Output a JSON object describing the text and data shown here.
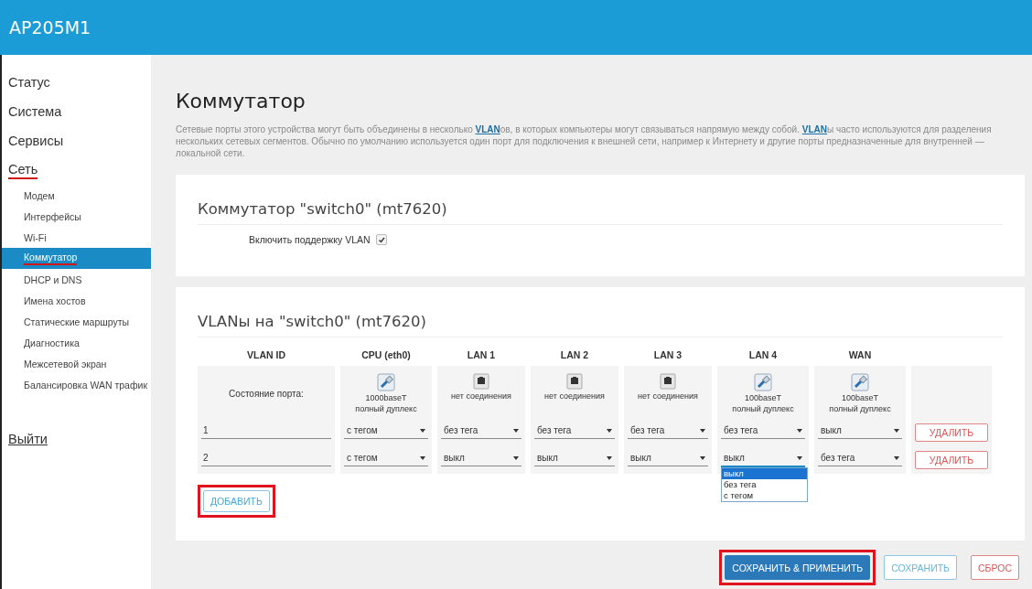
{
  "header": {
    "title": "AP205M1"
  },
  "sidebar": {
    "items": [
      {
        "label": "Статус",
        "selected": false,
        "annotated": false
      },
      {
        "label": "Система",
        "selected": false,
        "annotated": false
      },
      {
        "label": "Сервисы",
        "selected": false,
        "annotated": false
      },
      {
        "label": "Сеть",
        "selected": false,
        "annotated": true,
        "children": [
          {
            "label": "Модем",
            "selected": false,
            "annotated": false
          },
          {
            "label": "Интерфейсы",
            "selected": false,
            "annotated": false
          },
          {
            "label": "Wi-Fi",
            "selected": false,
            "annotated": false
          },
          {
            "label": "Коммутатор",
            "selected": true,
            "annotated": true
          },
          {
            "label": "DHCP и DNS",
            "selected": false,
            "annotated": false
          },
          {
            "label": "Имена хостов",
            "selected": false,
            "annotated": false
          },
          {
            "label": "Статические маршруты",
            "selected": false,
            "annotated": false
          },
          {
            "label": "Диагностика",
            "selected": false,
            "annotated": false
          },
          {
            "label": "Межсетевой экран",
            "selected": false,
            "annotated": false
          },
          {
            "label": "Балансировка WAN трафик",
            "selected": false,
            "annotated": false
          }
        ]
      }
    ],
    "logout": "Выйти"
  },
  "page": {
    "title": "Коммутатор",
    "description": [
      {
        "kind": "text",
        "text": "Сетевые порты этого устройства могут быть объединены в несколько "
      },
      {
        "kind": "link",
        "text": "VLAN"
      },
      {
        "kind": "text",
        "text": "ов, в которых компьютеры могут связываться напрямую между собой. "
      },
      {
        "kind": "link",
        "text": "VLAN"
      },
      {
        "kind": "text",
        "text": "ы часто используются для разделения нескольких сетевых сегментов. Обычно по умолчанию используется один порт для подключения к внешней сети, например к Интернету и другие порты предназначенные для внутренней — локальной сети."
      }
    ]
  },
  "switch_card": {
    "title": "Коммутатор \"switch0\" (mt7620)",
    "vlan_support": {
      "label": "Включить поддержку VLAN",
      "checked": true
    }
  },
  "vlan_card": {
    "title": "VLANы на \"switch0\" (mt7620)",
    "columns": [
      "VLAN ID",
      "CPU (eth0)",
      "LAN 1",
      "LAN 2",
      "LAN 3",
      "LAN 4",
      "WAN"
    ],
    "port_status_label": "Состояние порта:",
    "ports": [
      {
        "connected": true,
        "lines": [
          "1000baseT",
          "полный дуплекс"
        ]
      },
      {
        "connected": false,
        "lines": [
          "нет соединения"
        ]
      },
      {
        "connected": false,
        "lines": [
          "нет соединения"
        ]
      },
      {
        "connected": false,
        "lines": [
          "нет соединения"
        ]
      },
      {
        "connected": true,
        "lines": [
          "100baseT",
          "полный дуплекс"
        ]
      },
      {
        "connected": true,
        "lines": [
          "100baseT",
          "полный дуплекс"
        ]
      }
    ],
    "rows": [
      {
        "cells": [
          {
            "kind": "field",
            "value": "1"
          },
          {
            "kind": "select",
            "value": "с тегом",
            "open": false
          },
          {
            "kind": "select",
            "value": "без тега",
            "open": false
          },
          {
            "kind": "select",
            "value": "без тега",
            "open": false
          },
          {
            "kind": "select",
            "value": "без тега",
            "open": false
          },
          {
            "kind": "select",
            "value": "без тега",
            "open": false
          },
          {
            "kind": "select",
            "value": "выкл",
            "open": false
          }
        ],
        "delete": "УДАЛИТЬ"
      },
      {
        "cells": [
          {
            "kind": "field",
            "value": "2"
          },
          {
            "kind": "select",
            "value": "с тегом",
            "open": false
          },
          {
            "kind": "select",
            "value": "выкл",
            "open": false
          },
          {
            "kind": "select",
            "value": "выкл",
            "open": false
          },
          {
            "kind": "select",
            "value": "выкл",
            "open": false
          },
          {
            "kind": "select",
            "value": "выкл",
            "open": true,
            "options": [
              {
                "label": "выкл",
                "selected": true
              },
              {
                "label": "без тега",
                "selected": false
              },
              {
                "label": "с тегом",
                "selected": false
              }
            ]
          },
          {
            "kind": "select",
            "value": "без тега",
            "open": false
          }
        ],
        "delete": "УДАЛИТЬ"
      }
    ],
    "add_button": {
      "label": "ДОБАВИТЬ",
      "highlighted": true
    }
  },
  "footer_buttons": [
    {
      "kind": "primary",
      "label": "СОХРАНИТЬ & ПРИМЕНИТЬ",
      "highlighted": true
    },
    {
      "kind": "secondary",
      "label": "СОХРАНИТЬ",
      "highlighted": false
    },
    {
      "kind": "danger",
      "label": "СБРОС",
      "highlighted": false
    }
  ]
}
